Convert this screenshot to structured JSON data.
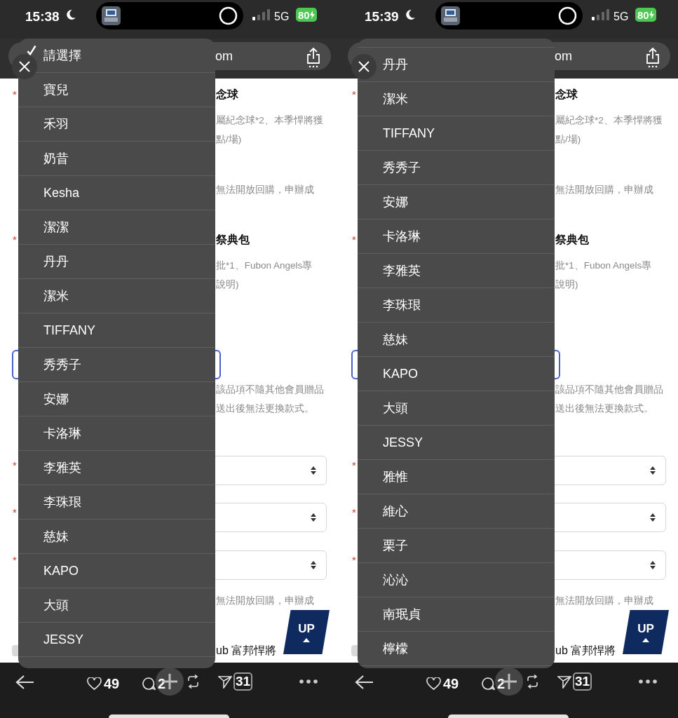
{
  "panels": [
    {
      "status_bar": {
        "time": "15:38",
        "network": "5G",
        "battery": "80"
      },
      "address_bar": {
        "text": "om"
      },
      "page": {
        "rows": [
          {
            "kind": "heading",
            "required_mark": "*",
            "text": "念球"
          },
          {
            "kind": "note",
            "text": "屬紀念球*2、本季悍將獲"
          },
          {
            "kind": "note",
            "text": "點/場)"
          },
          {
            "kind": "note",
            "text": "無法開放回購，申辦成"
          },
          {
            "kind": "heading",
            "required_mark": "*",
            "text": "祭典包"
          },
          {
            "kind": "note",
            "text": "批*1、Fubon Angels專"
          },
          {
            "kind": "note",
            "text": "說明)"
          },
          {
            "kind": "input"
          },
          {
            "kind": "note",
            "text": "該品項不隨其他會員贈品"
          },
          {
            "kind": "note",
            "text": "送出後無法更換款式。"
          },
          {
            "kind": "select",
            "required_mark": "*"
          },
          {
            "kind": "select",
            "required_mark": "*"
          },
          {
            "kind": "select",
            "required_mark": "*"
          },
          {
            "kind": "note",
            "text": "無法開放回購，申辦成"
          },
          {
            "kind": "footer",
            "text": "ub 富邦悍將"
          }
        ]
      },
      "menu": {
        "scrolled": false,
        "items": [
          {
            "label": "請選擇",
            "selected": true
          },
          {
            "label": "寶兒",
            "selected": false
          },
          {
            "label": "禾羽",
            "selected": false
          },
          {
            "label": "奶昔",
            "selected": false
          },
          {
            "label": "Kesha",
            "selected": false
          },
          {
            "label": "潔潔",
            "selected": false
          },
          {
            "label": "丹丹",
            "selected": false
          },
          {
            "label": "潔米",
            "selected": false
          },
          {
            "label": "TIFFANY",
            "selected": false
          },
          {
            "label": "秀秀子",
            "selected": false
          },
          {
            "label": "安娜",
            "selected": false
          },
          {
            "label": "卡洛琳",
            "selected": false
          },
          {
            "label": "李雅英",
            "selected": false
          },
          {
            "label": "李珠珢",
            "selected": false
          },
          {
            "label": "慈妹",
            "selected": false
          },
          {
            "label": "KAPO",
            "selected": false
          },
          {
            "label": "大頭",
            "selected": false
          },
          {
            "label": "JESSY",
            "selected": false
          }
        ]
      },
      "up_button": {
        "label": "UP"
      },
      "toolbar": {
        "likes": "49",
        "comments": "2",
        "shares": "31"
      }
    },
    {
      "status_bar": {
        "time": "15:39",
        "network": "5G",
        "battery": "80"
      },
      "address_bar": {
        "text": "om"
      },
      "page": {
        "rows": [
          {
            "kind": "heading",
            "required_mark": "*",
            "text": "念球"
          },
          {
            "kind": "note",
            "text": "屬紀念球*2、本季悍將獲"
          },
          {
            "kind": "note",
            "text": "點/場)"
          },
          {
            "kind": "note",
            "text": "無法開放回購，申辦成"
          },
          {
            "kind": "heading",
            "required_mark": "*",
            "text": "祭典包"
          },
          {
            "kind": "note",
            "text": "批*1、Fubon Angels專"
          },
          {
            "kind": "note",
            "text": "說明)"
          },
          {
            "kind": "input"
          },
          {
            "kind": "note",
            "text": "該品項不隨其他會員贈品"
          },
          {
            "kind": "note",
            "text": "送出後無法更換款式。"
          },
          {
            "kind": "select",
            "required_mark": "*"
          },
          {
            "kind": "select",
            "required_mark": "*"
          },
          {
            "kind": "select",
            "required_mark": "*"
          },
          {
            "kind": "note",
            "text": "無法開放回購，申辦成"
          },
          {
            "kind": "footer",
            "text": "ub 富邦悍將"
          }
        ]
      },
      "menu": {
        "scrolled": true,
        "items": [
          {
            "label": "丹丹",
            "selected": false
          },
          {
            "label": "潔米",
            "selected": false
          },
          {
            "label": "TIFFANY",
            "selected": false
          },
          {
            "label": "秀秀子",
            "selected": false
          },
          {
            "label": "安娜",
            "selected": false
          },
          {
            "label": "卡洛琳",
            "selected": false
          },
          {
            "label": "李雅英",
            "selected": false
          },
          {
            "label": "李珠珢",
            "selected": false
          },
          {
            "label": "慈妹",
            "selected": false
          },
          {
            "label": "KAPO",
            "selected": false
          },
          {
            "label": "大頭",
            "selected": false
          },
          {
            "label": "JESSY",
            "selected": false
          },
          {
            "label": "雅惟",
            "selected": false
          },
          {
            "label": "維心",
            "selected": false
          },
          {
            "label": "栗子",
            "selected": false
          },
          {
            "label": "沁沁",
            "selected": false
          },
          {
            "label": "南珉貞",
            "selected": false
          },
          {
            "label": "檸檬",
            "selected": false
          }
        ]
      },
      "up_button": {
        "label": "UP"
      },
      "toolbar": {
        "likes": "49",
        "comments": "2",
        "shares": "31"
      }
    }
  ]
}
